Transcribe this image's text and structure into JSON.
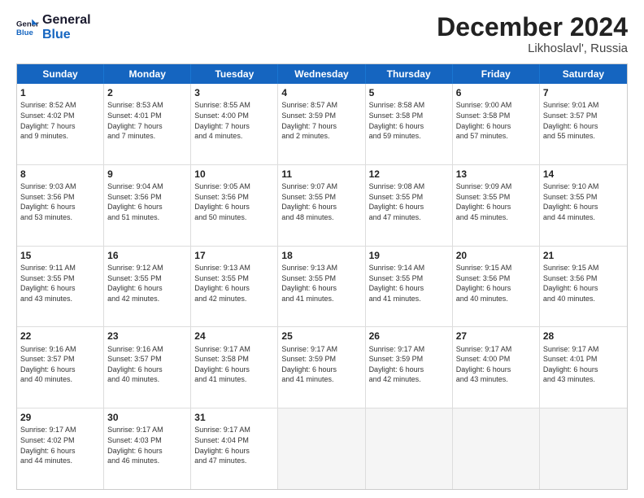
{
  "logo": {
    "line1": "General",
    "line2": "Blue"
  },
  "title": "December 2024",
  "location": "Likhoslavl', Russia",
  "days_of_week": [
    "Sunday",
    "Monday",
    "Tuesday",
    "Wednesday",
    "Thursday",
    "Friday",
    "Saturday"
  ],
  "weeks": [
    [
      {
        "day": "1",
        "info": "Sunrise: 8:52 AM\nSunset: 4:02 PM\nDaylight: 7 hours\nand 9 minutes."
      },
      {
        "day": "2",
        "info": "Sunrise: 8:53 AM\nSunset: 4:01 PM\nDaylight: 7 hours\nand 7 minutes."
      },
      {
        "day": "3",
        "info": "Sunrise: 8:55 AM\nSunset: 4:00 PM\nDaylight: 7 hours\nand 4 minutes."
      },
      {
        "day": "4",
        "info": "Sunrise: 8:57 AM\nSunset: 3:59 PM\nDaylight: 7 hours\nand 2 minutes."
      },
      {
        "day": "5",
        "info": "Sunrise: 8:58 AM\nSunset: 3:58 PM\nDaylight: 6 hours\nand 59 minutes."
      },
      {
        "day": "6",
        "info": "Sunrise: 9:00 AM\nSunset: 3:58 PM\nDaylight: 6 hours\nand 57 minutes."
      },
      {
        "day": "7",
        "info": "Sunrise: 9:01 AM\nSunset: 3:57 PM\nDaylight: 6 hours\nand 55 minutes."
      }
    ],
    [
      {
        "day": "8",
        "info": "Sunrise: 9:03 AM\nSunset: 3:56 PM\nDaylight: 6 hours\nand 53 minutes."
      },
      {
        "day": "9",
        "info": "Sunrise: 9:04 AM\nSunset: 3:56 PM\nDaylight: 6 hours\nand 51 minutes."
      },
      {
        "day": "10",
        "info": "Sunrise: 9:05 AM\nSunset: 3:56 PM\nDaylight: 6 hours\nand 50 minutes."
      },
      {
        "day": "11",
        "info": "Sunrise: 9:07 AM\nSunset: 3:55 PM\nDaylight: 6 hours\nand 48 minutes."
      },
      {
        "day": "12",
        "info": "Sunrise: 9:08 AM\nSunset: 3:55 PM\nDaylight: 6 hours\nand 47 minutes."
      },
      {
        "day": "13",
        "info": "Sunrise: 9:09 AM\nSunset: 3:55 PM\nDaylight: 6 hours\nand 45 minutes."
      },
      {
        "day": "14",
        "info": "Sunrise: 9:10 AM\nSunset: 3:55 PM\nDaylight: 6 hours\nand 44 minutes."
      }
    ],
    [
      {
        "day": "15",
        "info": "Sunrise: 9:11 AM\nSunset: 3:55 PM\nDaylight: 6 hours\nand 43 minutes."
      },
      {
        "day": "16",
        "info": "Sunrise: 9:12 AM\nSunset: 3:55 PM\nDaylight: 6 hours\nand 42 minutes."
      },
      {
        "day": "17",
        "info": "Sunrise: 9:13 AM\nSunset: 3:55 PM\nDaylight: 6 hours\nand 42 minutes."
      },
      {
        "day": "18",
        "info": "Sunrise: 9:13 AM\nSunset: 3:55 PM\nDaylight: 6 hours\nand 41 minutes."
      },
      {
        "day": "19",
        "info": "Sunrise: 9:14 AM\nSunset: 3:55 PM\nDaylight: 6 hours\nand 41 minutes."
      },
      {
        "day": "20",
        "info": "Sunrise: 9:15 AM\nSunset: 3:56 PM\nDaylight: 6 hours\nand 40 minutes."
      },
      {
        "day": "21",
        "info": "Sunrise: 9:15 AM\nSunset: 3:56 PM\nDaylight: 6 hours\nand 40 minutes."
      }
    ],
    [
      {
        "day": "22",
        "info": "Sunrise: 9:16 AM\nSunset: 3:57 PM\nDaylight: 6 hours\nand 40 minutes."
      },
      {
        "day": "23",
        "info": "Sunrise: 9:16 AM\nSunset: 3:57 PM\nDaylight: 6 hours\nand 40 minutes."
      },
      {
        "day": "24",
        "info": "Sunrise: 9:17 AM\nSunset: 3:58 PM\nDaylight: 6 hours\nand 41 minutes."
      },
      {
        "day": "25",
        "info": "Sunrise: 9:17 AM\nSunset: 3:59 PM\nDaylight: 6 hours\nand 41 minutes."
      },
      {
        "day": "26",
        "info": "Sunrise: 9:17 AM\nSunset: 3:59 PM\nDaylight: 6 hours\nand 42 minutes."
      },
      {
        "day": "27",
        "info": "Sunrise: 9:17 AM\nSunset: 4:00 PM\nDaylight: 6 hours\nand 43 minutes."
      },
      {
        "day": "28",
        "info": "Sunrise: 9:17 AM\nSunset: 4:01 PM\nDaylight: 6 hours\nand 43 minutes."
      }
    ],
    [
      {
        "day": "29",
        "info": "Sunrise: 9:17 AM\nSunset: 4:02 PM\nDaylight: 6 hours\nand 44 minutes."
      },
      {
        "day": "30",
        "info": "Sunrise: 9:17 AM\nSunset: 4:03 PM\nDaylight: 6 hours\nand 46 minutes."
      },
      {
        "day": "31",
        "info": "Sunrise: 9:17 AM\nSunset: 4:04 PM\nDaylight: 6 hours\nand 47 minutes."
      },
      {
        "day": "",
        "info": ""
      },
      {
        "day": "",
        "info": ""
      },
      {
        "day": "",
        "info": ""
      },
      {
        "day": "",
        "info": ""
      }
    ]
  ]
}
